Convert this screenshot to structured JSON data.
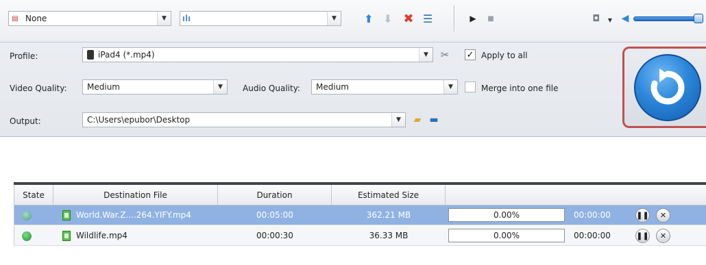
{
  "toolbar": {
    "subtitle_value": "None",
    "audio_track_value": "",
    "move_up_icon": "arrow-up-icon",
    "move_down_icon": "arrow-down-icon",
    "remove_icon": "x-icon",
    "clear_icon": "list-clear-icon",
    "play_icon": "play-icon",
    "stop_icon": "stop-icon",
    "snapshot_icon": "camera-icon",
    "volume_icon": "speaker-icon"
  },
  "settings": {
    "profile_label": "Profile:",
    "profile_value": "iPad4 (*.mp4)",
    "apply_all_label": "Apply to all",
    "video_quality_label": "Video Quality:",
    "video_quality_value": "Medium",
    "audio_quality_label": "Audio Quality:",
    "audio_quality_value": "Medium",
    "merge_label": "Merge into one file",
    "output_label": "Output:",
    "output_value": "C:\\Users\\epubor\\Desktop"
  },
  "table": {
    "headers": [
      "State",
      "Destination File",
      "Duration",
      "Estimated Size",
      ""
    ],
    "rows": [
      {
        "file": "World.War.Z....264.YIFY.mp4",
        "duration": "00:05:00",
        "size": "362.21 MB",
        "progress": "0.00%",
        "time": "00:00:00"
      },
      {
        "file": "Wildlife.mp4",
        "duration": "00:00:30",
        "size": "36.33 MB",
        "progress": "0.00%",
        "time": "00:00:00"
      }
    ]
  },
  "colors": {
    "selected_row": "#8fb2e3",
    "convert_button": "#2b86d9",
    "highlight_frame": "#c0504d"
  }
}
